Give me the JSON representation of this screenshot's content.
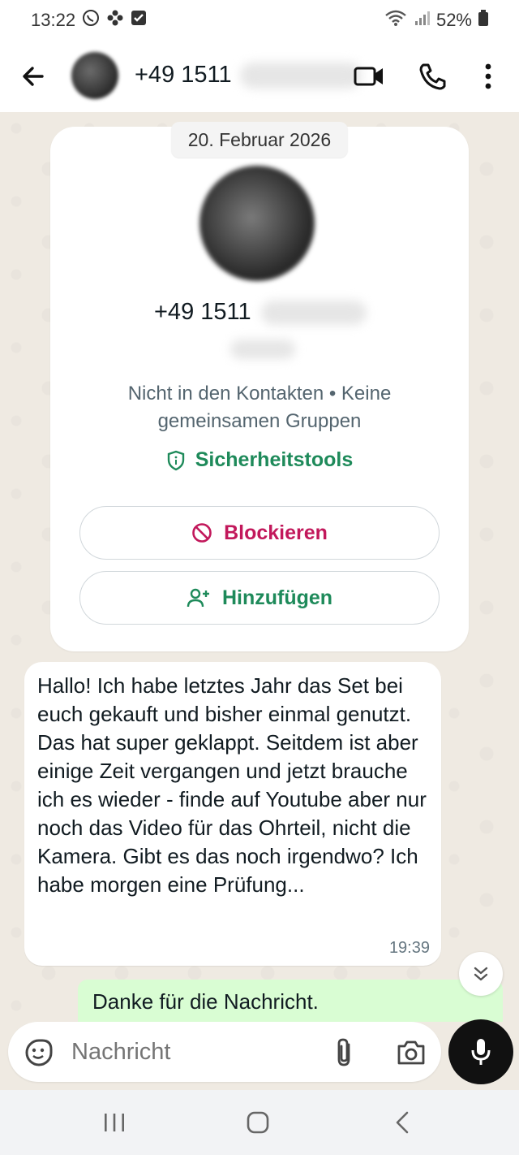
{
  "status_bar": {
    "time": "13:22",
    "battery": "52%"
  },
  "header": {
    "contact_number": "+49 1511"
  },
  "chat": {
    "date_label": "20. Februar 2026",
    "info_card": {
      "number": "+49 1511",
      "info_text": "Nicht in den Kontakten • Keine gemeinsamen Gruppen",
      "safety_tools_label": "Sicherheitstools",
      "block_label": "Blockieren",
      "add_label": "Hinzufügen"
    },
    "messages": [
      {
        "direction": "incoming",
        "text": "Hallo! Ich habe letztes Jahr das Set bei euch gekauft und bisher einmal genutzt. Das hat super geklappt. Seitdem ist aber einige Zeit vergangen und jetzt brauche ich es wieder - finde auf Youtube aber nur noch das Video für das Ohrteil, nicht die Kamera. Gibt es das noch irgendwo? Ich habe morgen eine Prüfung...",
        "time": "19:39"
      },
      {
        "direction": "outgoing",
        "text": "Danke für die Nachricht."
      }
    ]
  },
  "composer": {
    "placeholder": "Nachricht"
  },
  "colors": {
    "accent_green": "#1e8a5a",
    "block_red": "#c2185b",
    "outgoing_bubble": "#d9fdd3",
    "chat_background": "#efeae2"
  },
  "icons": {
    "status": [
      "whatsapp-icon",
      "flower-icon",
      "checkbox-icon",
      "wifi-icon",
      "signal-icon",
      "battery-icon"
    ],
    "header": [
      "back-arrow-icon",
      "video-call-icon",
      "phone-icon",
      "more-vertical-icon"
    ],
    "card": [
      "shield-icon",
      "block-icon",
      "add-person-icon"
    ],
    "composer": [
      "sticker-icon",
      "paperclip-icon",
      "camera-icon",
      "microphone-icon"
    ],
    "nav": [
      "recents-icon",
      "home-icon",
      "back-chevron-icon"
    ]
  }
}
